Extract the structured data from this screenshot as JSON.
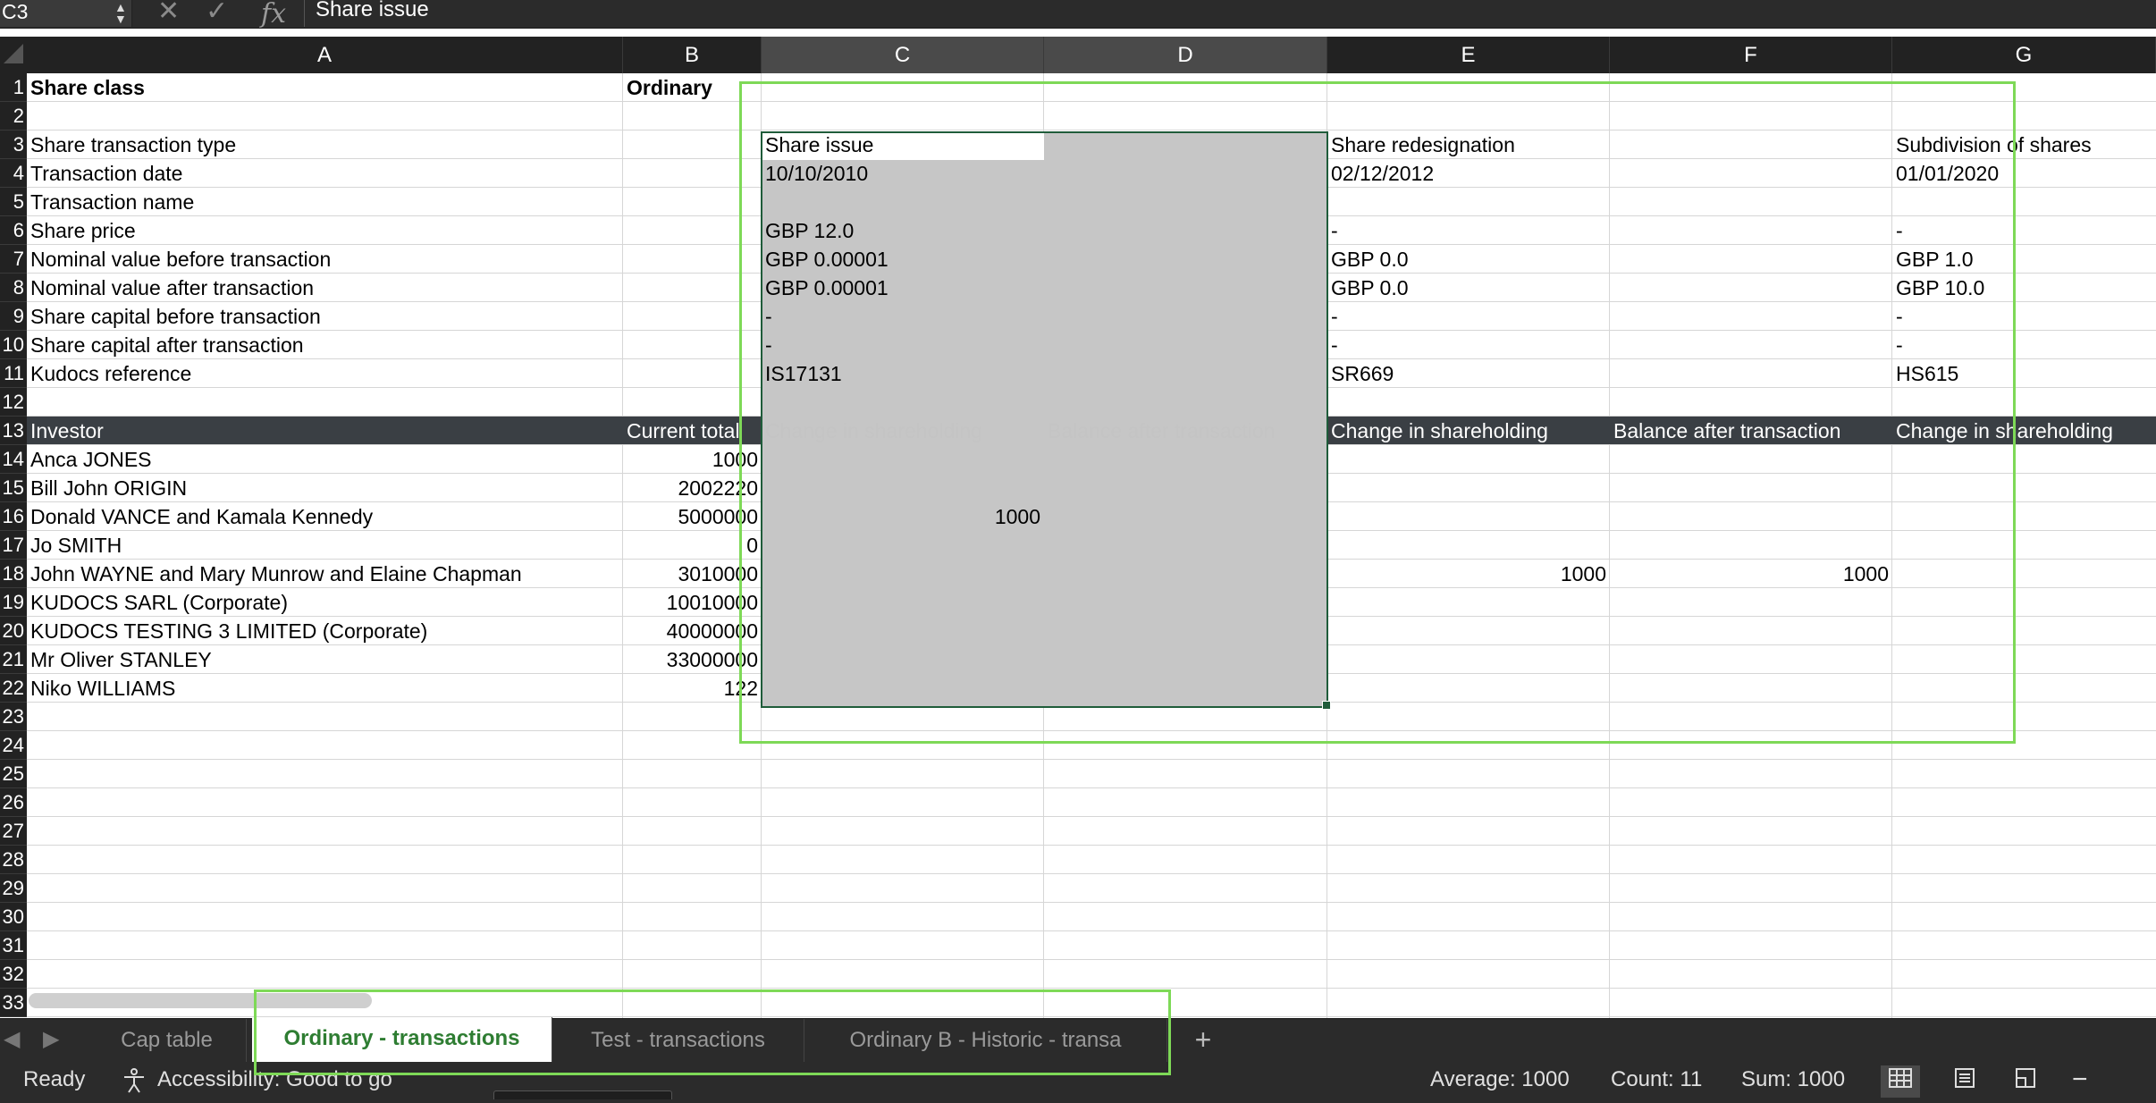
{
  "formula_bar": {
    "name_box": "C3",
    "cancel_icon": "✕",
    "enter_icon": "✓",
    "fx_label": "fx",
    "content": "Share issue"
  },
  "columns": [
    "A",
    "B",
    "C",
    "D",
    "E",
    "F",
    "G"
  ],
  "rows": [
    "1",
    "2",
    "3",
    "4",
    "5",
    "6",
    "7",
    "8",
    "9",
    "10",
    "11",
    "12",
    "13",
    "14",
    "15",
    "16",
    "17",
    "18",
    "19",
    "20",
    "21",
    "22",
    "23",
    "24",
    "25",
    "26",
    "27",
    "28",
    "29",
    "30",
    "31",
    "32",
    "33"
  ],
  "cells": {
    "A1": "Share class",
    "B1": "Ordinary",
    "A3": "Share transaction type",
    "C3": "Share issue",
    "E3": "Share redesignation",
    "G3": "Subdivision of shares",
    "A4": "Transaction date",
    "C4": "10/10/2010",
    "E4": "02/12/2012",
    "G4": "01/01/2020",
    "A5": "Transaction name",
    "A6": "Share price",
    "C6": "GBP 12.0",
    "E6": "-",
    "G6": "-",
    "A7": "Nominal value before transaction",
    "C7": "GBP 0.00001",
    "E7": "GBP 0.0",
    "G7": "GBP 1.0",
    "A8": "Nominal value after transaction",
    "C8": "GBP 0.00001",
    "E8": "GBP 0.0",
    "G8": "GBP 10.0",
    "A9": "Share capital before transaction",
    "C9": "-",
    "E9": "-",
    "G9": "-",
    "A10": "Share capital after transaction",
    "C10": "-",
    "E10": "-",
    "G10": "-",
    "A11": "Kudocs reference",
    "C11": "IS17131",
    "E11": "SR669",
    "G11": "HS615",
    "A13": "Investor",
    "B13": "Current total",
    "C13": "Change in shareholding",
    "D13": "Balance after transaction",
    "E13": "Change in shareholding",
    "F13": "Balance after transaction",
    "G13": "Change in shareholding",
    "A14": "Anca JONES",
    "B14": "1000",
    "A15": "Bill John ORIGIN",
    "B15": "2002220",
    "A16": "Donald VANCE and Kamala Kennedy",
    "B16": "5000000",
    "C16": "1000",
    "A17": "Jo SMITH",
    "B17": "0",
    "A18": "John WAYNE and Mary Munrow and Elaine Chapman",
    "B18": "3010000",
    "E18": "1000",
    "F18": "1000",
    "A19": "KUDOCS SARL (Corporate)",
    "B19": "10010000",
    "A20": "KUDOCS TESTING 3 LIMITED (Corporate)",
    "B20": "40000000",
    "A21": "Mr Oliver STANLEY",
    "B21": "33000000",
    "A22": "Niko WILLIAMS",
    "B22": "122"
  },
  "tabs": {
    "prev": "◀",
    "next": "▶",
    "items": [
      "Cap table",
      "Ordinary - transactions",
      "Test - transactions",
      "Ordinary B - Historic - transa"
    ],
    "active_index": 1,
    "add": "+"
  },
  "status": {
    "ready": "Ready",
    "accessibility": "Accessibility: Good to go",
    "average": "Average: 1000",
    "count": "Count: 11",
    "sum": "Sum: 1000",
    "zoom_out": "−"
  },
  "colors": {
    "selection_border": "#1f5c3a",
    "active_tab_text": "#2e7d32",
    "header_band": "#3a3f44",
    "highlight": "#7ed957"
  }
}
